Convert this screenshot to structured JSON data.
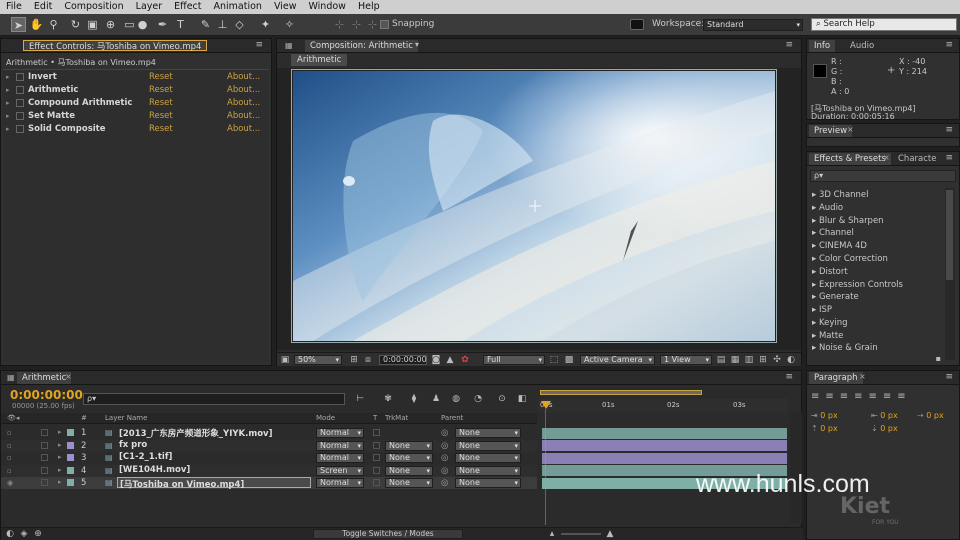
{
  "menu": [
    "File",
    "Edit",
    "Composition",
    "Layer",
    "Effect",
    "Animation",
    "View",
    "Window",
    "Help"
  ],
  "toolbar": {
    "snapping_label": "Snapping",
    "workspace_label": "Workspace:",
    "workspace_value": "Standard",
    "search_placeholder": "Search Help"
  },
  "effect_controls": {
    "tab_label": "Effect Controls: 马Toshiba on Vimeo.mp4",
    "breadcrumb": "Arithmetic • 马Toshiba on Vimeo.mp4",
    "effects": [
      {
        "name": "Invert",
        "reset": "Reset",
        "about": "About..."
      },
      {
        "name": "Arithmetic",
        "reset": "Reset",
        "about": "About..."
      },
      {
        "name": "Compound Arithmetic",
        "reset": "Reset",
        "about": "About..."
      },
      {
        "name": "Set Matte",
        "reset": "Reset",
        "about": "About..."
      },
      {
        "name": "Solid Composite",
        "reset": "Reset",
        "about": "About..."
      }
    ]
  },
  "composition": {
    "tab_label": "Composition: Arithmetic",
    "sub_tab": "Arithmetic",
    "zoom": "50%",
    "timecode": "0:00:00:00",
    "resolution": "Full",
    "camera": "Active Camera",
    "views": "1 View"
  },
  "info": {
    "tab_info": "Info",
    "tab_audio": "Audio",
    "r": "R :",
    "g": "G :",
    "b": "B :",
    "a": "A : 0",
    "x": "X : -40",
    "y": "Y : 214",
    "file": "[马Toshiba on Vimeo.mp4]",
    "duration": "Duration: 0:00:05:16"
  },
  "preview_tab": "Preview",
  "effects_presets": {
    "tab_label": "Effects & Presets",
    "tab_character": "Characte",
    "search_value": "ρ▾",
    "categories": [
      "3D Channel",
      "Audio",
      "Blur & Sharpen",
      "Channel",
      "CINEMA 4D",
      "Color Correction",
      "Distort",
      "Expression Controls",
      "Generate",
      "ISP",
      "Keying",
      "Matte",
      "Noise & Grain"
    ]
  },
  "paragraph": {
    "tab_label": "Paragraph",
    "fields": [
      "0 px",
      "0 px",
      "0 px",
      "0 px",
      "0 px"
    ]
  },
  "timeline": {
    "tab_label": "Arithmetic",
    "timecode": "0:00:00:00",
    "frames": "00000 (25.00 fps)",
    "search_value": "ρ▾",
    "col_num": "#",
    "col_layer": "Layer Name",
    "col_mode": "Mode",
    "col_t": "T",
    "col_trkmat": "TrkMat",
    "col_parent": "Parent",
    "ruler": [
      "00s",
      "01s",
      "02s",
      "03s"
    ],
    "toggle_label": "Toggle Switches / Modes",
    "layers": [
      {
        "num": "1",
        "name": "[2013_广东房产频道形象_YIYK.mov]",
        "mode": "Normal",
        "trkmat": "",
        "parent": "None",
        "color": "#7fb0a8"
      },
      {
        "num": "2",
        "name": "fx pro",
        "mode": "Normal",
        "trkmat": "None",
        "parent": "None",
        "color": "#9b8fcf"
      },
      {
        "num": "3",
        "name": "[C1-2_1.tif]",
        "mode": "Normal",
        "trkmat": "None",
        "parent": "None",
        "color": "#9b8fcf"
      },
      {
        "num": "4",
        "name": "[WE104H.mov]",
        "mode": "Screen",
        "trkmat": "None",
        "parent": "None",
        "color": "#7fb0a8"
      },
      {
        "num": "5",
        "name": "[马Toshiba on Vimeo.mp4]",
        "mode": "Normal",
        "trkmat": "None",
        "parent": "None",
        "color": "#7fb0a8"
      }
    ]
  },
  "watermark": {
    "site": "www.hunls.com",
    "brand": "Kiet",
    "tag": "FOR YOU"
  }
}
